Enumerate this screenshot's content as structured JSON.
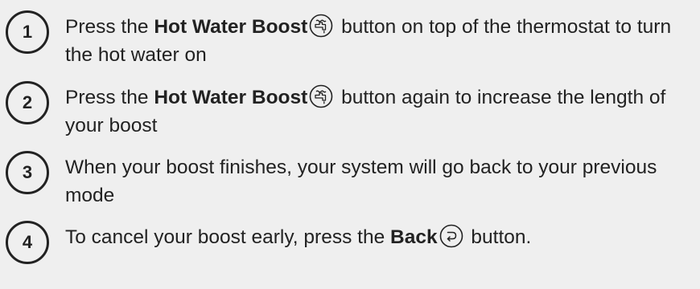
{
  "steps": [
    {
      "number": "1",
      "before": "Press the ",
      "bold": "Hot Water Boost",
      "icon": "tap-icon",
      "after": " button on top of the thermostat to turn the hot water on"
    },
    {
      "number": "2",
      "before": "Press the ",
      "bold": "Hot Water Boost",
      "icon": "tap-icon",
      "after": " button again to increase the length of your boost"
    },
    {
      "number": "3",
      "text": "When your boost finishes, your system will go back to your previous mode"
    },
    {
      "number": "4",
      "before": "To cancel your boost early, press the ",
      "bold": "Back",
      "icon": "back-arrow-icon",
      "after": " button."
    }
  ],
  "colors": {
    "background": "#efefef",
    "text": "#222222"
  }
}
